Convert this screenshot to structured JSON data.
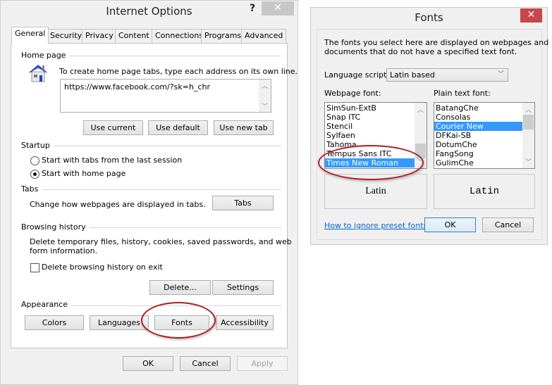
{
  "internet_options": {
    "title": "Internet Options",
    "help_label": "?",
    "close_label": "✕",
    "tabs": [
      {
        "label": "General",
        "active": true
      },
      {
        "label": "Security"
      },
      {
        "label": "Privacy"
      },
      {
        "label": "Content"
      },
      {
        "label": "Connections"
      },
      {
        "label": "Programs"
      },
      {
        "label": "Advanced"
      }
    ],
    "home_page": {
      "label": "Home page",
      "icon": "house-icon",
      "instructions": "To create home page tabs, type each address on its own line.",
      "url_value": "https://www.facebook.com/?sk=h_chr",
      "buttons": [
        "Use current",
        "Use default",
        "Use new tab"
      ]
    },
    "startup": {
      "label": "Startup",
      "options": [
        {
          "label": "Start with tabs from the last session",
          "selected": false
        },
        {
          "label": "Start with home page",
          "selected": true
        }
      ]
    },
    "tabs_section": {
      "label": "Tabs",
      "description": "Change how webpages are displayed in tabs.",
      "button": "Tabs"
    },
    "browsing_history": {
      "label": "Browsing history",
      "description_line1": "Delete temporary files, history, cookies, saved passwords, and web",
      "description_line2": "form information.",
      "checkbox_label": "Delete browsing history on exit",
      "checkbox_checked": false,
      "buttons": [
        "Delete...",
        "Settings"
      ]
    },
    "appearance": {
      "label": "Appearance",
      "buttons": [
        "Colors",
        "Languages",
        "Fonts",
        "Accessibility"
      ]
    },
    "footer": {
      "ok": "OK",
      "cancel": "Cancel",
      "apply": "Apply"
    }
  },
  "fonts_dialog": {
    "title": "Fonts",
    "close_label": "✕",
    "description_line1": "The fonts you select here are displayed on webpages and",
    "description_line2": "documents that do not have a specified text font.",
    "language_script_label": "Language script:",
    "language_script_value": "Latin based",
    "webpage_font": {
      "label": "Webpage font:",
      "items": [
        "SimSun-ExtB",
        "Snap ITC",
        "Stencil",
        "Sylfaen",
        "Tahoma",
        "Tempus Sans ITC",
        "Times New Roman"
      ],
      "selected": "Times New Roman",
      "preview": "Latin"
    },
    "plain_text_font": {
      "label": "Plain text font:",
      "items": [
        "BatangChe",
        "Consolas",
        "Courier New",
        "DFKai-SB",
        "DotumChe",
        "FangSong",
        "GulimChe"
      ],
      "selected": "Courier New",
      "preview": "Latin"
    },
    "help_link": "How to ignore preset fonts",
    "ok": "OK",
    "cancel": "Cancel"
  },
  "colors": {
    "highlight_ring": "#b01c22",
    "selection": "#3399ff",
    "close_red": "#c7474a",
    "close_gray": "#c7c7c7"
  }
}
